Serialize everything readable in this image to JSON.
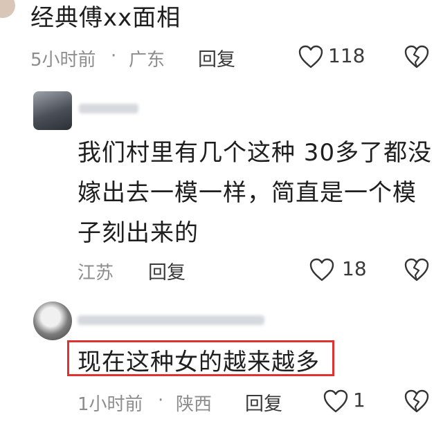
{
  "comment1": {
    "text": "经典傅xx面相",
    "time": "5小时前",
    "location": "广东",
    "reply_label": "回复",
    "likes": "118"
  },
  "reply1": {
    "lines": [
      "我们村里有几个这种 30多了都没",
      "嫁出去一模一样，简直是一个模",
      "子刻出来的"
    ],
    "location": "江苏",
    "reply_label": "回复",
    "likes": "18"
  },
  "reply2": {
    "text": "现在这种女的越来越多",
    "time": "1小时前",
    "location": "陕西",
    "reply_label": "回复",
    "likes": "1"
  },
  "icons": [
    "heart-icon",
    "broken-heart-icon"
  ],
  "colors": {
    "highlight": "#e03030",
    "meta_gray": "#8d8d8d"
  }
}
